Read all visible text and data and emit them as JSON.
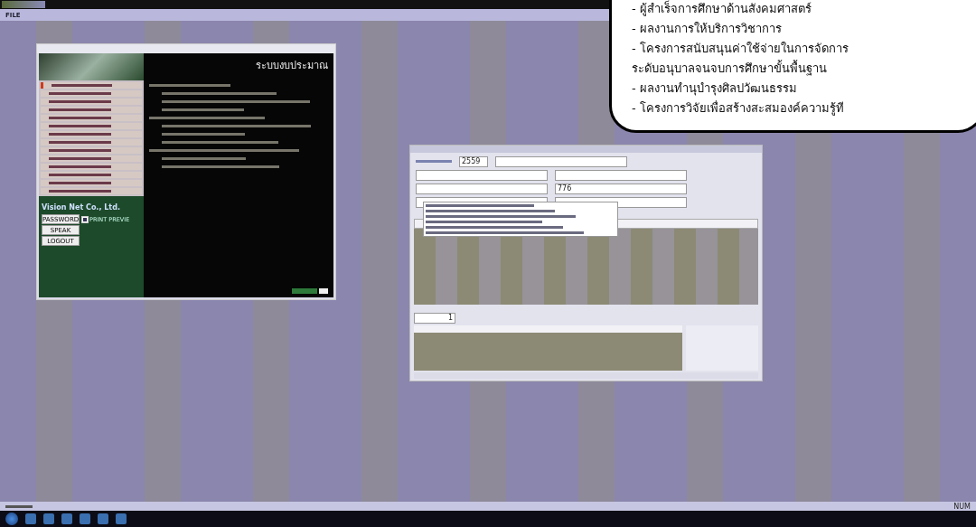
{
  "menu": [
    "FILE"
  ],
  "budget_window": {
    "heading": "ระบบงบประมาณ",
    "company": "Vision Net Co., Ltd.",
    "buttons": [
      "PASSWORD",
      "SPEAK",
      "LOGOUT"
    ],
    "print_preview": {
      "label": "PRINT PREVIE",
      "checked": true
    }
  },
  "sidebar": [
    {
      "selected": true
    },
    {
      "selected": false
    },
    {
      "selected": false
    },
    {
      "selected": false
    },
    {
      "selected": false
    },
    {
      "selected": false
    },
    {
      "selected": false
    },
    {
      "selected": false
    },
    {
      "selected": false
    },
    {
      "selected": false
    },
    {
      "selected": false
    },
    {
      "selected": false
    },
    {
      "selected": false
    },
    {
      "selected": false
    }
  ],
  "entry_window": {
    "year": "2559",
    "code": "776",
    "pager_value": "1"
  },
  "callout": {
    "lines": [
      "- ผู้สำเร็จการศึกษาด้านสังคมศาสตร์",
      "- ผลงานการให้บริการวิชาการ",
      "- โครงการสนับสนุนค่าใช้จ่ายในการจัดการ",
      "ระดับอนุบาลจนจบการศึกษาขั้นพื้นฐาน",
      "- ผลงานทำนุบำรุงศิลปวัฒนธรรม",
      "- โครงการวิจัยเพื่อสร้างสะสมองค์ความรู้ที"
    ]
  },
  "status_bar": {
    "right": "NUM"
  }
}
